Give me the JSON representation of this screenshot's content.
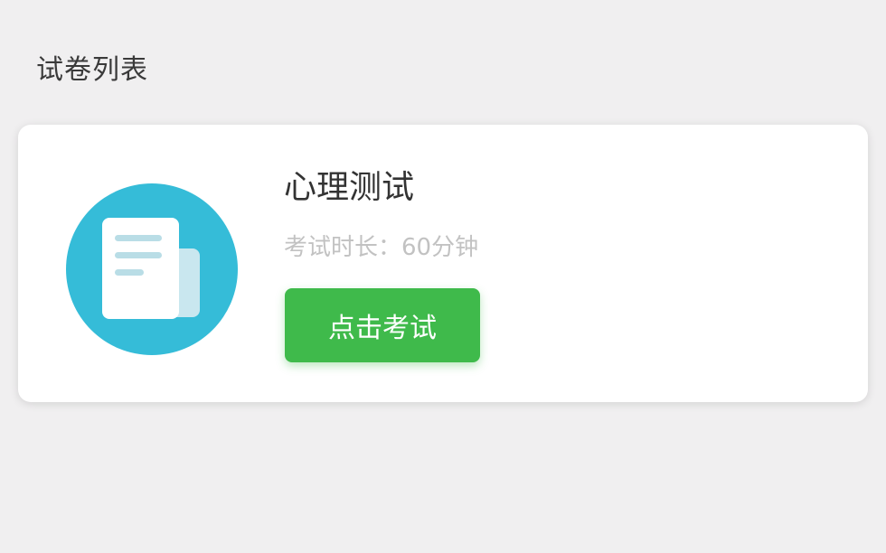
{
  "section": {
    "title": "试卷列表"
  },
  "exam_list": [
    {
      "name": "心理测试",
      "duration": "考试时长：60分钟",
      "start_label": "点击考试",
      "icon": "document-icon"
    }
  ],
  "colors": {
    "background": "#f0eff0",
    "card": "#ffffff",
    "icon_circle": "#35bcd8",
    "icon_lines": "#b9dde6",
    "button": "#3fba4b",
    "title_text": "#333333",
    "muted_text": "#c2c2c2"
  }
}
